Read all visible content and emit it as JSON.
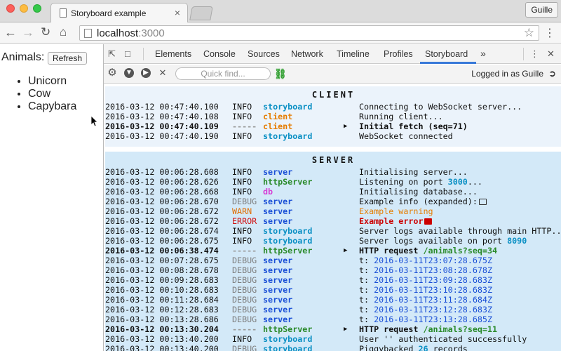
{
  "browser": {
    "tab_title": "Storyboard example",
    "tab_close": "×",
    "profile_name": "Guille",
    "url_host": "localhost",
    "url_port": ":3000"
  },
  "page": {
    "animals_label": "Animals:",
    "refresh_label": "Refresh",
    "animals": [
      "Unicorn",
      "Cow",
      "Capybara"
    ]
  },
  "devtools": {
    "tabs": [
      "Elements",
      "Console",
      "Sources",
      "Network",
      "Timeline",
      "Profiles",
      "Storyboard"
    ],
    "active_tab": "Storyboard",
    "more": "»",
    "quick_find_placeholder": "Quick find...",
    "logged_in_text": "Logged in as Guille"
  },
  "client": {
    "title": "CLIENT",
    "rows": [
      {
        "ts": "2016-03-12 00:47:40.100",
        "lvl": "INFO",
        "lvlClass": "lvl-info",
        "src": "storyboard",
        "srcColor": "#0b90c4",
        "msg": "Connecting to WebSocket server...",
        "bold": false
      },
      {
        "ts": "2016-03-12 00:47:40.108",
        "lvl": "INFO",
        "lvlClass": "lvl-info",
        "src": "client",
        "srcColor": "#e57c00",
        "msg": "Running client...",
        "bold": false
      },
      {
        "ts": "2016-03-12 00:47:40.109",
        "lvl": "-----",
        "lvlClass": "lvl-group",
        "src": "client",
        "srcColor": "#e57c00",
        "msg": "Initial fetch (seq=71)",
        "bold": true,
        "arrow": true
      },
      {
        "ts": "2016-03-12 00:47:40.190",
        "lvl": "INFO",
        "lvlClass": "lvl-info",
        "src": "storyboard",
        "srcColor": "#0b90c4",
        "msg": "WebSocket connected",
        "bold": false
      }
    ]
  },
  "server": {
    "title": "SERVER",
    "rows": [
      {
        "ts": "2016-03-12 00:06:28.608",
        "lvl": "INFO",
        "lvlClass": "lvl-info",
        "src": "server",
        "srcColor": "#1a4fd6",
        "msg": "Initialising server...",
        "bold": false
      },
      {
        "ts": "2016-03-12 00:06:28.626",
        "lvl": "INFO",
        "lvlClass": "lvl-info",
        "src": "httpServer",
        "srcColor": "#2a8a2a",
        "msg": "Listening on port ",
        "msgHl": "3000",
        "msgHlClass": "hl-blue",
        "msgTail": "...",
        "bold": false
      },
      {
        "ts": "2016-03-12 00:06:28.668",
        "lvl": "INFO",
        "lvlClass": "lvl-info",
        "src": "db",
        "srcColor": "#d63fd6",
        "msg": "Initialising database...",
        "bold": false
      },
      {
        "ts": "2016-03-12 00:06:28.670",
        "lvl": "DEBUG",
        "lvlClass": "lvl-debug",
        "src": "server",
        "srcColor": "#1a4fd6",
        "msg": "Example info (expanded):",
        "folder": "plain",
        "bold": false
      },
      {
        "ts": "2016-03-12 00:06:28.672",
        "lvl": "WARN",
        "lvlClass": "lvl-warn",
        "src": "server",
        "srcColor": "#1a4fd6",
        "msg": "Example warning",
        "msgClass": "msg-warn",
        "bold": false
      },
      {
        "ts": "2016-03-12 00:06:28.672",
        "lvl": "ERROR",
        "lvlClass": "lvl-error",
        "src": "server",
        "srcColor": "#1a4fd6",
        "msg": "Example error",
        "msgClass": "msg-error",
        "folder": "red",
        "bold": false
      },
      {
        "ts": "2016-03-12 00:06:28.674",
        "lvl": "INFO",
        "lvlClass": "lvl-info",
        "src": "storyboard",
        "srcColor": "#0b90c4",
        "msg": "Server logs available through main HTTP...",
        "bold": false
      },
      {
        "ts": "2016-03-12 00:06:28.675",
        "lvl": "INFO",
        "lvlClass": "lvl-info",
        "src": "storyboard",
        "srcColor": "#0b90c4",
        "msg": "Server logs available on port ",
        "msgHl": "8090",
        "msgHlClass": "hl-blue",
        "bold": false
      },
      {
        "ts": "2016-03-12 00:06:38.474",
        "lvl": "-----",
        "lvlClass": "lvl-group",
        "src": "httpServer",
        "srcColor": "#2a8a2a",
        "msg": "HTTP request ",
        "msgHl": "/animals?seq=34",
        "msgHlClass": "hl-green",
        "bold": true,
        "arrow": true
      },
      {
        "ts": "2016-03-12 00:07:28.675",
        "lvl": "DEBUG",
        "lvlClass": "lvl-debug",
        "src": "server",
        "srcColor": "#1a4fd6",
        "msg": "t: ",
        "msgHl": "2016-03-11T23:07:28.675Z",
        "msgHlClass": "ts-link",
        "bold": false
      },
      {
        "ts": "2016-03-12 00:08:28.678",
        "lvl": "DEBUG",
        "lvlClass": "lvl-debug",
        "src": "server",
        "srcColor": "#1a4fd6",
        "msg": "t: ",
        "msgHl": "2016-03-11T23:08:28.678Z",
        "msgHlClass": "ts-link",
        "bold": false
      },
      {
        "ts": "2016-03-12 00:09:28.683",
        "lvl": "DEBUG",
        "lvlClass": "lvl-debug",
        "src": "server",
        "srcColor": "#1a4fd6",
        "msg": "t: ",
        "msgHl": "2016-03-11T23:09:28.683Z",
        "msgHlClass": "ts-link",
        "bold": false
      },
      {
        "ts": "2016-03-12 00:10:28.683",
        "lvl": "DEBUG",
        "lvlClass": "lvl-debug",
        "src": "server",
        "srcColor": "#1a4fd6",
        "msg": "t: ",
        "msgHl": "2016-03-11T23:10:28.683Z",
        "msgHlClass": "ts-link",
        "bold": false
      },
      {
        "ts": "2016-03-12 00:11:28.684",
        "lvl": "DEBUG",
        "lvlClass": "lvl-debug",
        "src": "server",
        "srcColor": "#1a4fd6",
        "msg": "t: ",
        "msgHl": "2016-03-11T23:11:28.684Z",
        "msgHlClass": "ts-link",
        "bold": false
      },
      {
        "ts": "2016-03-12 00:12:28.683",
        "lvl": "DEBUG",
        "lvlClass": "lvl-debug",
        "src": "server",
        "srcColor": "#1a4fd6",
        "msg": "t: ",
        "msgHl": "2016-03-11T23:12:28.683Z",
        "msgHlClass": "ts-link",
        "bold": false
      },
      {
        "ts": "2016-03-12 00:13:28.686",
        "lvl": "DEBUG",
        "lvlClass": "lvl-debug",
        "src": "server",
        "srcColor": "#1a4fd6",
        "msg": "t: ",
        "msgHl": "2016-03-11T23:13:28.685Z",
        "msgHlClass": "ts-link",
        "bold": false
      },
      {
        "ts": "2016-03-12 00:13:30.204",
        "lvl": "-----",
        "lvlClass": "lvl-group",
        "src": "httpServer",
        "srcColor": "#2a8a2a",
        "msg": "HTTP request ",
        "msgHl": "/animals?seq=11",
        "msgHlClass": "hl-green",
        "bold": true,
        "arrow": true
      },
      {
        "ts": "2016-03-12 00:13:40.200",
        "lvl": "INFO",
        "lvlClass": "lvl-info",
        "src": "storyboard",
        "srcColor": "#0b90c4",
        "msg": "User '' authenticated successfully",
        "bold": false
      },
      {
        "ts": "2016-03-12 00:13:40.200",
        "lvl": "DEBUG",
        "lvlClass": "lvl-debug",
        "src": "storyboard",
        "srcColor": "#0b90c4",
        "msg": "Piggybacked ",
        "msgHl": "26",
        "msgHlClass": "hl-blue",
        "msgTail": " records",
        "bold": false
      }
    ]
  }
}
